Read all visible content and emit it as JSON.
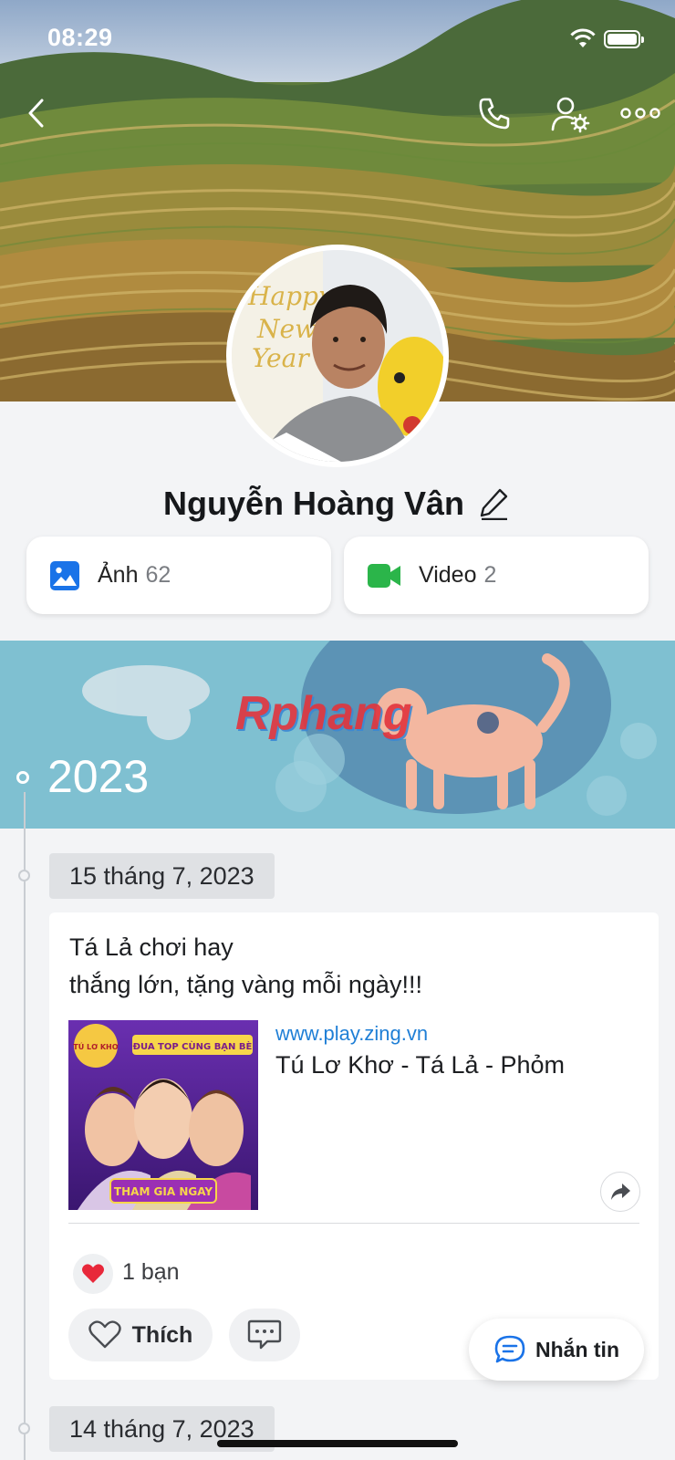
{
  "status_bar": {
    "time": "08:29",
    "wifi_icon": "wifi-icon",
    "battery_icon": "battery-icon"
  },
  "header": {
    "back_icon": "chevron-left-icon",
    "call_icon": "phone-icon",
    "settings_icon": "user-settings-icon",
    "more_icon": "more-horizontal-icon"
  },
  "profile": {
    "name": "Nguyễn Hoàng Vân",
    "edit_icon": "pencil-icon"
  },
  "media": {
    "photos": {
      "label": "Ảnh",
      "count": "62",
      "icon": "image-icon",
      "color": "#1a73e8"
    },
    "videos": {
      "label": "Video",
      "count": "2",
      "icon": "video-camera-icon",
      "color": "#2bb54a"
    }
  },
  "timeline": {
    "year": "2023",
    "banner_text": "Rphang",
    "posts": [
      {
        "date": "15 tháng 7, 2023",
        "text": "Tá Lả chơi hay\n thắng lớn, tặng vàng mỗi ngày!!!",
        "link": {
          "domain": "www.play.zing.vn",
          "title": "Tú Lơ Khơ - Tá Lả - Phỏm",
          "thumb_top": "ĐUA TOP CÙNG BẠN BÈ",
          "thumb_logo": "TÚ LƠ KHƠ",
          "thumb_cta": "THAM GIA NGAY"
        },
        "reactions": {
          "icon": "heart-icon",
          "count_label": "1 bạn"
        },
        "actions": {
          "like_label": "Thích",
          "comment_icon": "comment-icon",
          "share_icon": "share-icon"
        }
      },
      {
        "date": "14 tháng 7, 2023"
      }
    ]
  },
  "floating": {
    "message_label": "Nhắn tin",
    "message_icon": "chat-bubble-icon"
  },
  "colors": {
    "accent": "#1a73e8",
    "link": "#1f7fd6",
    "heart": "#e8283a",
    "banner": "#7fc0d1"
  }
}
